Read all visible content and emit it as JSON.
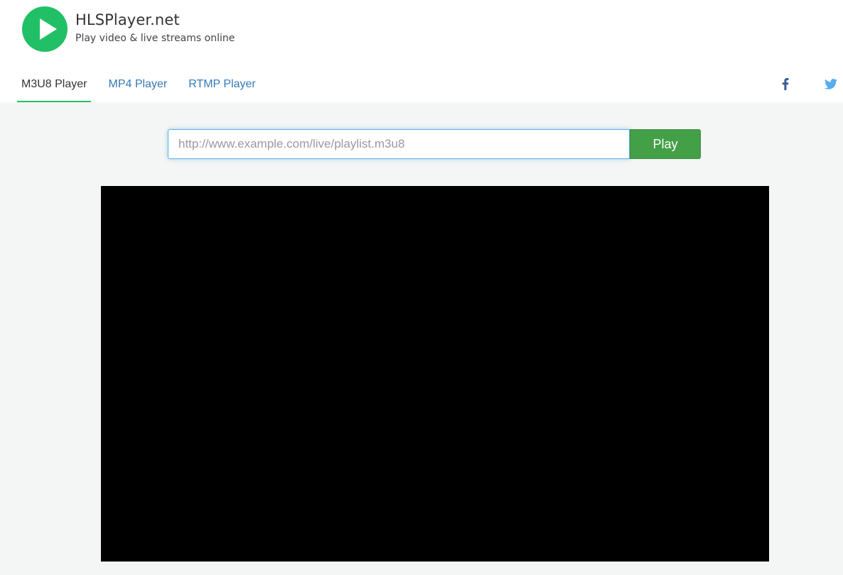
{
  "brand": {
    "title": "HLSPlayer.net",
    "subtitle": "Play video & live streams online",
    "logo_icon": "play-circle-icon",
    "logo_color": "#22c066"
  },
  "nav": {
    "tabs": [
      {
        "label": "M3U8 Player",
        "active": true
      },
      {
        "label": "MP4 Player",
        "active": false
      },
      {
        "label": "RTMP Player",
        "active": false
      }
    ],
    "active_color": "#22c066",
    "link_color": "#337ab7"
  },
  "social": {
    "facebook_icon": "facebook-icon",
    "twitter_icon": "twitter-icon",
    "facebook_color": "#3b5998",
    "twitter_color": "#55acee"
  },
  "player": {
    "url_value": "",
    "url_placeholder": "http://www.example.com/live/playlist.m3u8",
    "play_label": "Play",
    "play_color": "#43a047"
  }
}
